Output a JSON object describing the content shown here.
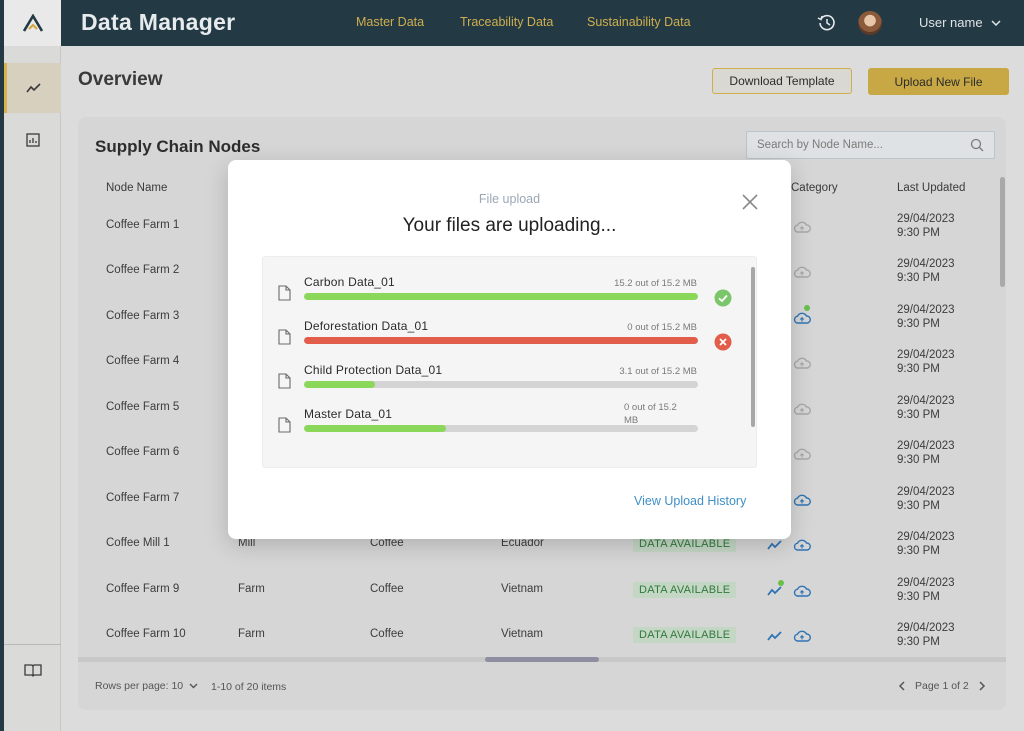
{
  "app": {
    "title": "Data Manager"
  },
  "nav": [
    "Master Data",
    "Traceability Data",
    "Sustainability Data"
  ],
  "user": {
    "name": "User name"
  },
  "page": {
    "title": "Overview",
    "download_template": "Download Template",
    "upload_new_file": "Upload New File"
  },
  "card": {
    "title": "Supply Chain Nodes",
    "search_placeholder": "Search by Node Name..."
  },
  "table": {
    "columns": {
      "node_name": "Node Name",
      "category": "Category",
      "last_updated": "Last Updated"
    },
    "rows": [
      {
        "name": "Coffee Farm 1",
        "type": "",
        "commodity": "",
        "country": "",
        "status": "",
        "date": "29/04/2023",
        "time": "9:30 PM"
      },
      {
        "name": "Coffee Farm 2",
        "type": "",
        "commodity": "",
        "country": "",
        "status": "",
        "date": "29/04/2023",
        "time": "9:30 PM"
      },
      {
        "name": "Coffee Farm 3",
        "type": "",
        "commodity": "",
        "country": "",
        "status": "",
        "date": "29/04/2023",
        "time": "9:30 PM"
      },
      {
        "name": "Coffee Farm 4",
        "type": "",
        "commodity": "",
        "country": "",
        "status": "",
        "date": "29/04/2023",
        "time": "9:30 PM"
      },
      {
        "name": "Coffee Farm 5",
        "type": "",
        "commodity": "",
        "country": "",
        "status": "",
        "date": "29/04/2023",
        "time": "9:30 PM"
      },
      {
        "name": "Coffee Farm 6",
        "type": "",
        "commodity": "",
        "country": "",
        "status": "",
        "date": "29/04/2023",
        "time": "9:30 PM"
      },
      {
        "name": "Coffee Farm 7",
        "type": "",
        "commodity": "",
        "country": "",
        "status": "",
        "date": "29/04/2023",
        "time": "9:30 PM"
      },
      {
        "name": "Coffee Mill 1",
        "type": "Mill",
        "commodity": "Coffee",
        "country": "Ecuador",
        "status": "DATA AVAILABLE",
        "date": "29/04/2023",
        "time": "9:30 PM"
      },
      {
        "name": "Coffee Farm 9",
        "type": "Farm",
        "commodity": "Coffee",
        "country": "Vietnam",
        "status": "DATA AVAILABLE",
        "date": "29/04/2023",
        "time": "9:30 PM"
      },
      {
        "name": "Coffee Farm 10",
        "type": "Farm",
        "commodity": "Coffee",
        "country": "Vietnam",
        "status": "DATA AVAILABLE",
        "date": "29/04/2023",
        "time": "9:30 PM"
      }
    ]
  },
  "footer": {
    "rows_per_page": "Rows per page: 10",
    "range": "1-10 of 20 items",
    "page": "Page 1 of 2"
  },
  "modal": {
    "subtitle": "File upload",
    "title": "Your files are uploading...",
    "files": [
      {
        "name": "Carbon Data_01",
        "size": "15.2 out of 15.2 MB",
        "progress": 1.0,
        "color": "#8bd75a",
        "status": "complete"
      },
      {
        "name": "Deforestation Data_01",
        "size": "0 out of 15.2 MB",
        "progress": 1.0,
        "color": "#e35d4b",
        "status": "error"
      },
      {
        "name": "Child Protection Data_01",
        "size": "3.1 out of 15.2 MB",
        "progress": 0.18,
        "color": "#8bd75a",
        "status": "uploading"
      },
      {
        "name": "Master Data_01",
        "size": "0 out of 15.2 MB",
        "progress": 0.36,
        "color": "#8bd75a",
        "status": "uploading"
      }
    ],
    "history_link": "View Upload History"
  },
  "colors": {
    "topbar": "#233a45",
    "accent_gold": "#c8a745",
    "success": "#7bc66b",
    "error": "#e35d4b",
    "link": "#3f8fc6"
  }
}
